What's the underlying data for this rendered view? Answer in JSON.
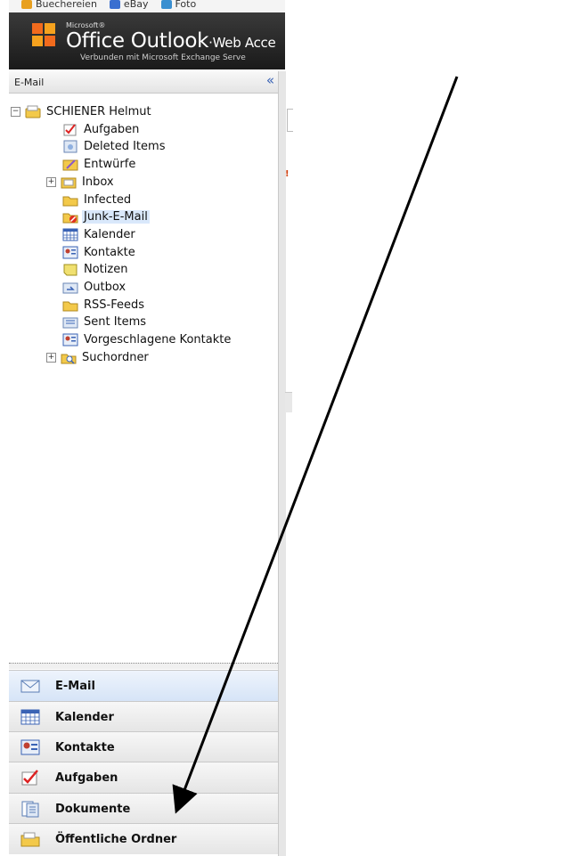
{
  "browser": {
    "favorites": [
      {
        "label": "Buechereien",
        "color": "#e8a020"
      },
      {
        "label": "eBay",
        "color": "#3a6fd0"
      },
      {
        "label": "Foto",
        "color": "#3a8fd0"
      }
    ]
  },
  "header": {
    "microsoft": "Microsoft®",
    "product": "Office Outlook",
    "product_suffix": "·Web Acce",
    "connected": "Verbunden mit Microsoft Exchange Serve"
  },
  "pane": {
    "title": "E-Mail",
    "collapse_glyph": "«"
  },
  "tree": {
    "root": "SCHIENER Helmut",
    "folders": [
      {
        "label": "Aufgaben",
        "icon": "tasks-icon"
      },
      {
        "label": "Deleted Items",
        "icon": "deleted-items-icon"
      },
      {
        "label": "Entwürfe",
        "icon": "drafts-icon"
      },
      {
        "label": "Inbox",
        "icon": "inbox-icon",
        "expandable": true
      },
      {
        "label": "Infected",
        "icon": "folder-icon"
      },
      {
        "label": "Junk-E-Mail",
        "icon": "junk-icon",
        "selected": true
      },
      {
        "label": "Kalender",
        "icon": "calendar-icon"
      },
      {
        "label": "Kontakte",
        "icon": "contacts-icon"
      },
      {
        "label": "Notizen",
        "icon": "notes-icon"
      },
      {
        "label": "Outbox",
        "icon": "outbox-icon"
      },
      {
        "label": "RSS-Feeds",
        "icon": "folder-icon"
      },
      {
        "label": "Sent Items",
        "icon": "sent-items-icon"
      },
      {
        "label": "Vorgeschlagene Kontakte",
        "icon": "contacts-icon"
      },
      {
        "label": "Suchordner",
        "icon": "search-folder-icon",
        "expandable": true
      }
    ]
  },
  "nav": {
    "items": [
      {
        "label": "E-Mail",
        "icon": "mail-icon",
        "active": true
      },
      {
        "label": "Kalender",
        "icon": "calendar-icon"
      },
      {
        "label": "Kontakte",
        "icon": "contacts-icon"
      },
      {
        "label": "Aufgaben",
        "icon": "tasks-icon"
      },
      {
        "label": "Dokumente",
        "icon": "documents-icon"
      },
      {
        "label": "Öffentliche Ordner",
        "icon": "public-folders-icon"
      }
    ]
  },
  "colors": {
    "header": "#2a2a2a",
    "selection": "#d9e8fb",
    "folder_yellow": "#f3c94a",
    "accent_blue": "#3a63b5"
  }
}
